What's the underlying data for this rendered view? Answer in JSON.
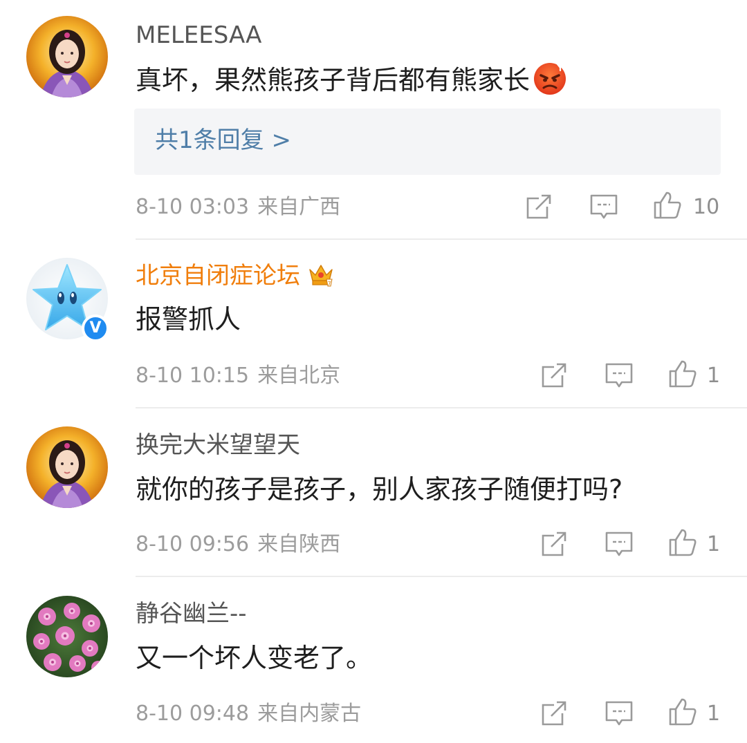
{
  "comments": [
    {
      "username": "MELEESAA",
      "content": "真坏，果然熊孩子背后都有熊家长",
      "emoji": "angry-face",
      "reply_link": "共1条回复 >",
      "date": "8-10 03:03",
      "source": "来自广西",
      "likes": "10",
      "avatar": "avatar-portrait-golden"
    },
    {
      "username": "北京自闭症论坛",
      "username_color": "#f07e0c",
      "badge": "crown",
      "verified": true,
      "content": "报警抓人",
      "date": "8-10 10:15",
      "source": "来自北京",
      "likes": "1",
      "avatar": "avatar-blue-star"
    },
    {
      "username": "换完大米望望天",
      "content": "就你的孩子是孩子，别人家孩子随便打吗?",
      "date": "8-10 09:56",
      "source": "来自陕西",
      "likes": "1",
      "avatar": "avatar-portrait-golden"
    },
    {
      "username": "静谷幽兰--",
      "content": "又一个坏人变老了。",
      "date": "8-10 09:48",
      "source": "来自内蒙古",
      "likes": "1",
      "avatar": "avatar-pink-flowers"
    }
  ],
  "colors": {
    "link": "#4f7ea8",
    "meta": "#9c9c9c",
    "vip_name": "#f07e0c",
    "verified": "#1f8bf0"
  }
}
